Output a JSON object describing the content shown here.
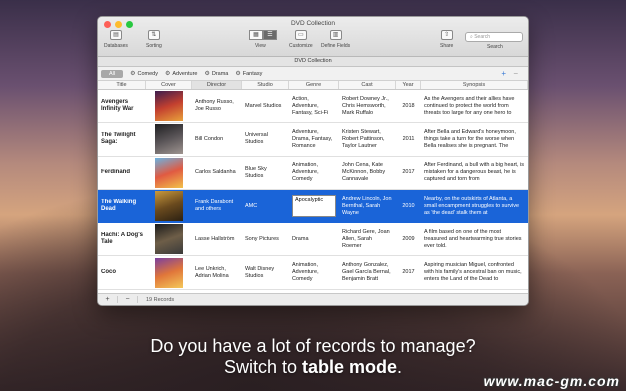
{
  "window": {
    "title": "DVD Collection",
    "subtitle": "DVD Collection"
  },
  "toolbar": {
    "databases": "Databases",
    "sorting": "Sorting",
    "view": "View",
    "customize": "Customize",
    "define_fields": "Define Fields",
    "share": "Share",
    "search_label": "Search",
    "search_placeholder": "Search"
  },
  "filters": [
    "All",
    "Comedy",
    "Adventure",
    "Drama",
    "Fantasy"
  ],
  "columns": [
    "Title",
    "Cover",
    "Director",
    "Studio",
    "Genre",
    "Cast",
    "Year",
    "Synopsis"
  ],
  "rows": [
    {
      "title": "Avengers Infinity War",
      "director": "Anthony Russo, Joe Russo",
      "studio": "Marvel Studios",
      "genre": "Action, Adventure, Fantasy, Sci-Fi",
      "cast": "Robert Downey Jr., Chris Hemsworth, Mark Ruffalo",
      "year": "2018",
      "synopsis": "As the Avengers and their allies have continued to protect the world from threats too large for any one hero to",
      "cover_color": "#6b2a5a"
    },
    {
      "title": "The Twilight Saga:",
      "director": "Bill Condon",
      "studio": "Universal Studios",
      "genre": "Adventure, Drama, Fantasy, Romance",
      "cast": "Kristen Stewart, Robert Pattinson, Taylor Lautner",
      "year": "2011",
      "synopsis": "After Bella and Edward's honeymoon, things take a turn for the worse when Bella realises she is pregnant. The",
      "cover_color": "#3c3b3f"
    },
    {
      "title": "Ferdinand",
      "director": "Carlos Saldanha",
      "studio": "Blue Sky Studios",
      "genre": "Animation, Adventure, Comedy",
      "cast": "John Cena, Kate McKinnon, Bobby Cannavale",
      "year": "2017",
      "synopsis": "After Ferdinand, a bull with a big heart, is mistaken for a dangerous beast, he is captured and torn from",
      "cover_color": "#c8483a"
    },
    {
      "title": "The Walking Dead",
      "director": "Frank Darabont and others",
      "studio": "AMC",
      "genre": "Apocalyptic",
      "cast": "Andrew Lincoln, Jon Bernthal, Sarah Wayne",
      "year": "2010",
      "synopsis": "Nearby, on the outskirts of Atlanta, a small encampment struggles to survive as 'the dead' stalk them at",
      "cover_color": "#8a6a2a",
      "selected": true
    },
    {
      "title": "Hachi: A Dog's Tale",
      "director": "Lasse Hallström",
      "studio": "Sony Pictures",
      "genre": "Drama",
      "cast": "Richard Gere, Joan Allen, Sarah Roemer",
      "year": "2009",
      "synopsis": "A film based on one of the most treasured and heartwarming true stories ever told.",
      "cover_color": "#3a3a3a"
    },
    {
      "title": "Coco",
      "director": "Lee Unkrich, Adrian Molina",
      "studio": "Walt Disney Studios",
      "genre": "Animation, Adventure, Comedy",
      "cast": "Anthony Gonzalez, Gael García Bernal, Benjamin Bratt",
      "year": "2017",
      "synopsis": "Aspiring musician Miguel, confronted with his family's ancestral ban on music, enters the Land of the Dead to",
      "cover_color": "#d9783a"
    }
  ],
  "footer": {
    "add": "+",
    "remove": "−",
    "count": "19 Records"
  },
  "caption": {
    "line1": "Do you have a lot of records to manage?",
    "line2_prefix": "Switch to ",
    "line2_bold": "table mode",
    "line2_suffix": "."
  },
  "watermark": "www.mac-gm.com",
  "colors": {
    "selection": "#1a64d8",
    "accent": "#3b7cd6"
  }
}
